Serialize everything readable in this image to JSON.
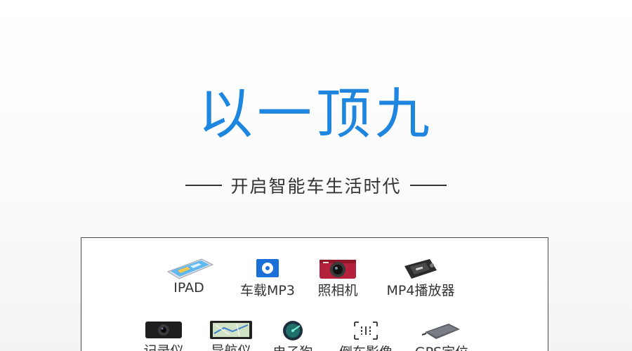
{
  "headline": "以一顶九",
  "subtitle": "开启智能车生活时代",
  "devices_row1": [
    {
      "label": "IPAD",
      "icon": "tablet-icon"
    },
    {
      "label": "车载MP3",
      "icon": "mp3-player-icon"
    },
    {
      "label": "照相机",
      "icon": "camera-icon"
    },
    {
      "label": "MP4播放器",
      "icon": "mp4-player-icon"
    }
  ],
  "devices_row2": [
    {
      "label": "记录仪",
      "icon": "dashcam-icon"
    },
    {
      "label": "导航仪",
      "icon": "gps-navigator-icon"
    },
    {
      "label": "电子狗",
      "icon": "radar-detector-icon"
    },
    {
      "label": "倒车影像",
      "icon": "reverse-camera-icon"
    },
    {
      "label": "GPS定位",
      "icon": "gps-tracker-icon"
    }
  ],
  "colors": {
    "headline": "#1f86e0",
    "text": "#333333",
    "border": "#4a4a4a"
  }
}
